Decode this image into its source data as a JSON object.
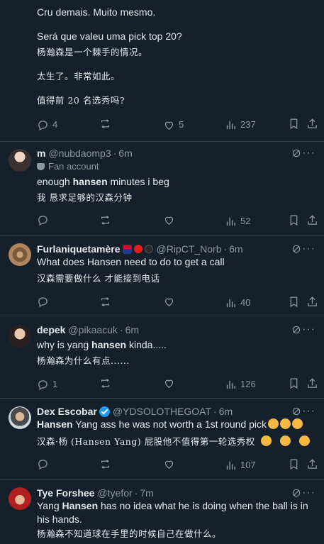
{
  "post0": {
    "lines": [
      "Cru demais. Muito mesmo.",
      "Será que valeu uma pick top 20?",
      "杨瀚森是一个棘手的情况。",
      "太生了。非常如此。",
      "值得前 20 名选秀吗?"
    ],
    "replies": "4",
    "reposts": "",
    "likes": "5",
    "views": "237"
  },
  "post1": {
    "name": "m",
    "handle": "@nubdaomp3",
    "time": "6m",
    "fan_label": "Fan account",
    "text_before": "enough ",
    "text_bold": "hansen",
    "text_after": " minutes i beg",
    "translation": "我 恳求足够的汉森分钟",
    "replies": "",
    "reposts": "",
    "likes": "",
    "views": "52"
  },
  "post2": {
    "name": "Furlaniquetamère",
    "handle": "@RipCT_Norb",
    "time": "6m",
    "text": "What does Hansen need to do to get a call",
    "translation": "汉森需要做什么 才能接到电话",
    "replies": "",
    "reposts": "",
    "likes": "",
    "views": "40"
  },
  "post3": {
    "name": "depek",
    "handle": "@pikaacuk",
    "time": "6m",
    "text_before": "why is yang ",
    "text_bold": "hansen",
    "text_after": " kinda.....",
    "translation": "杨瀚森为什么有点......",
    "replies": "1",
    "reposts": "",
    "likes": "",
    "views": "126"
  },
  "post4": {
    "name": "Dex Escobar",
    "handle": "@YDSOLOTHEGOAT",
    "time": "6m",
    "text_before": "",
    "text_bold": "Hansen",
    "text_after": " Yang ass he was not worth a 1st round pick",
    "translation": "汉森·杨 (Hansen Yang) 屁股他不值得第一轮选秀权",
    "replies": "",
    "reposts": "",
    "likes": "",
    "views": "107"
  },
  "post5": {
    "name": "Tye Forshee",
    "handle": "@tyefor",
    "time": "7m",
    "text_before": "Yang ",
    "text_bold": "Hansen",
    "text_after": " has no idea what he is doing when the ball is in his hands.",
    "translation": "杨瀚森不知道球在手里的时候自己在做什么。"
  },
  "colors": {
    "background": "#15202b",
    "text": "#e7e9ea",
    "muted": "#8b98a5",
    "accent": "#1d9bf0"
  }
}
